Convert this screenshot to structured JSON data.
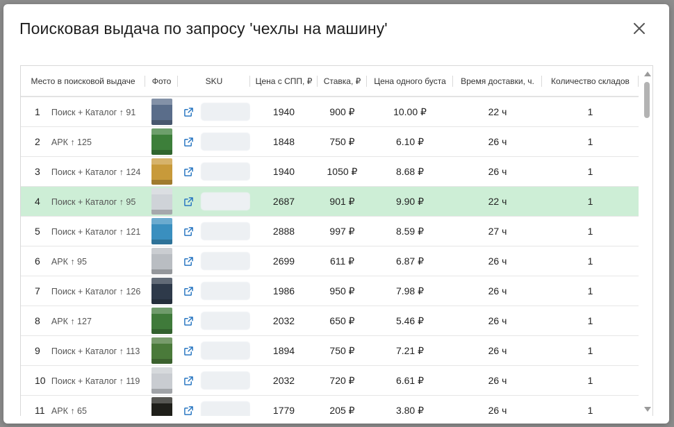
{
  "modal": {
    "title": "Поисковая выдача по запросу 'чехлы на машину'",
    "columns": [
      "Место в поисковой выдаче",
      "Фото",
      "SKU",
      "Цена с СПП, ₽",
      "Ставка, ₽",
      "Цена одного буста",
      "Время доставки, ч.",
      "Количество складов"
    ],
    "rows": [
      {
        "num": "1",
        "source": "Поиск + Каталог ↑ 91",
        "price": "1940",
        "bid": "900 ₽",
        "boost": "10.00 ₽",
        "delivery": "22 ч",
        "warehouses": "1",
        "photo": "#5a6d8a"
      },
      {
        "num": "2",
        "source": "АРК ↑ 125",
        "price": "1848",
        "bid": "750 ₽",
        "boost": "6.10 ₽",
        "delivery": "26 ч",
        "warehouses": "1",
        "photo": "#3d7f3a"
      },
      {
        "num": "3",
        "source": "Поиск + Каталог ↑ 124",
        "price": "1940",
        "bid": "1050 ₽",
        "boost": "8.68 ₽",
        "delivery": "26 ч",
        "warehouses": "1",
        "photo": "#c89a3a"
      },
      {
        "num": "4",
        "source": "Поиск + Каталог ↑ 95",
        "price": "2687",
        "bid": "901 ₽",
        "boost": "9.90 ₽",
        "delivery": "22 ч",
        "warehouses": "1",
        "photo": "#cfd3d8"
      },
      {
        "num": "5",
        "source": "Поиск + Каталог ↑ 121",
        "price": "2888",
        "bid": "997 ₽",
        "boost": "8.59 ₽",
        "delivery": "27 ч",
        "warehouses": "1",
        "photo": "#3a8fbf"
      },
      {
        "num": "6",
        "source": "АРК ↑ 95",
        "price": "2699",
        "bid": "611 ₽",
        "boost": "6.87 ₽",
        "delivery": "26 ч",
        "warehouses": "1",
        "photo": "#b9bdc2"
      },
      {
        "num": "7",
        "source": "Поиск + Каталог ↑ 126",
        "price": "1986",
        "bid": "950 ₽",
        "boost": "7.98 ₽",
        "delivery": "26 ч",
        "warehouses": "1",
        "photo": "#2e3a4a"
      },
      {
        "num": "8",
        "source": "АРК ↑ 127",
        "price": "2032",
        "bid": "650 ₽",
        "boost": "5.46 ₽",
        "delivery": "26 ч",
        "warehouses": "1",
        "photo": "#3f7a3a"
      },
      {
        "num": "9",
        "source": "Поиск + Каталог ↑ 113",
        "price": "1894",
        "bid": "750 ₽",
        "boost": "7.21 ₽",
        "delivery": "26 ч",
        "warehouses": "1",
        "photo": "#4a7a3a"
      },
      {
        "num": "10",
        "source": "Поиск + Каталог ↑ 119",
        "price": "2032",
        "bid": "720 ₽",
        "boost": "6.61 ₽",
        "delivery": "26 ч",
        "warehouses": "1",
        "photo": "#c9ccd1"
      },
      {
        "num": "11",
        "source": "АРК ↑ 65",
        "price": "1779",
        "bid": "205 ₽",
        "boost": "3.80 ₽",
        "delivery": "26 ч",
        "warehouses": "1",
        "photo": "#1f1f1a"
      }
    ],
    "highlight_row_index": 3,
    "colors": {
      "highlight": "#cdeed6",
      "link_icon": "#2b78c2"
    }
  },
  "icons": {
    "close": "close-icon",
    "link": "external-link-icon"
  }
}
